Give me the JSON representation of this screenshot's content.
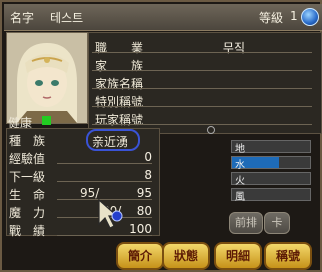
{
  "header": {
    "name_label": "名字",
    "name_value": "테스트",
    "level_label": "等級",
    "level_value": "1"
  },
  "profile": {
    "job_label": "職　　業",
    "job_value": "무직",
    "family_label": "家　　族",
    "family_title_label": "家族名稱",
    "special_title_label": "特別稱號",
    "player_title_label": "玩家稱號",
    "health_label": "健康",
    "race_label": "種　族",
    "race_value": "亲近湧",
    "exp_label": "經驗值",
    "exp_value": "0",
    "next_level_label": "下一級",
    "next_level_value": "8",
    "life_label": "生　命",
    "life_current": "95/",
    "life_max": "95",
    "mana_label": "魔　力",
    "mana_current": "80/",
    "mana_max": "80",
    "battle_label": "戰　績",
    "battle_value": "100"
  },
  "elements": {
    "earth": "地",
    "water": "水",
    "fire": "火",
    "wind": "風",
    "earth_level": 0.0,
    "water_level": 0.6,
    "fire_level": 0.0,
    "wind_level": 0.0
  },
  "small_buttons": {
    "prev_label": "前排",
    "card_label": "卡"
  },
  "tabs": {
    "intro": "簡介",
    "status": "狀態",
    "detail": "明細",
    "title": "稱號"
  },
  "colors": {
    "water_fill": "#1e6bb8",
    "health_status": "#22cc22"
  }
}
